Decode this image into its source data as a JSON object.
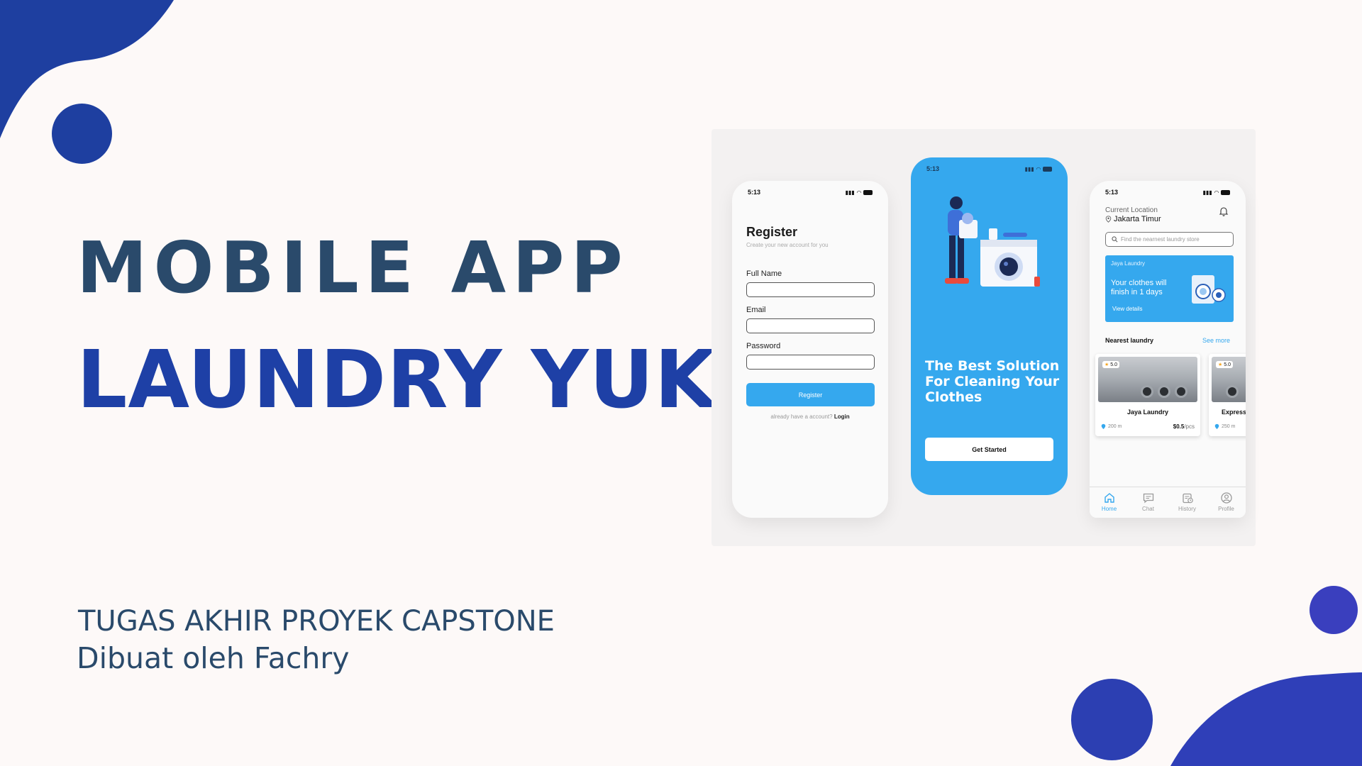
{
  "slide": {
    "title_line1": "MOBILE APP",
    "title_line2": "LAUNDRY YUK",
    "subtitle_line1": "TUGAS AKHIR PROYEK CAPSTONE",
    "subtitle_line2": "Dibuat oleh Fachry"
  },
  "colors": {
    "primary_blue": "#1e40a6",
    "dark_slate": "#2a4a6b",
    "app_blue": "#35a8ee",
    "background": "#fdf9f8"
  },
  "register_screen": {
    "time": "5:13",
    "battery": "96",
    "title": "Register",
    "subtitle": "Create your new account for you",
    "fields": [
      {
        "label": "Full Name",
        "value": ""
      },
      {
        "label": "Email",
        "value": ""
      },
      {
        "label": "Password",
        "value": ""
      }
    ],
    "register_button": "Register",
    "login_prompt": "already have a account?",
    "login_link": "Login"
  },
  "onboarding_screen": {
    "time": "5:13",
    "headline": "The Best Solution For Cleaning Your Clothes",
    "button": "Get Started"
  },
  "home_screen": {
    "time": "5:13",
    "location_label": "Current Location",
    "location_value": "Jakarta Timur",
    "search_placeholder": "Find the nearnest laundry store",
    "order_card": {
      "store": "Jaya Laundry",
      "message": "Your clothes will finish in 1 days",
      "link": "View details"
    },
    "nearest_label": "Nearest laundry",
    "see_more": "See more",
    "stores": [
      {
        "name": "Jaya Laundry",
        "rating": "5.0",
        "distance": "200 m",
        "price": "$0.5",
        "unit": "/pcs"
      },
      {
        "name": "Express",
        "rating": "5.0",
        "distance": "250 m"
      }
    ],
    "nav": [
      {
        "label": "Home",
        "icon": "home-icon",
        "active": true
      },
      {
        "label": "Chat",
        "icon": "chat-icon",
        "active": false
      },
      {
        "label": "History",
        "icon": "history-icon",
        "active": false
      },
      {
        "label": "Profile",
        "icon": "profile-icon",
        "active": false
      }
    ]
  }
}
